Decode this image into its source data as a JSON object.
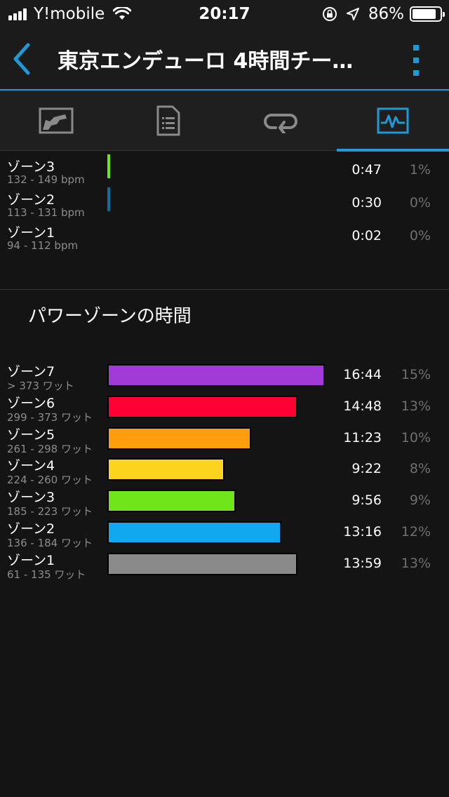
{
  "status_bar": {
    "carrier": "Y!mobile",
    "time": "20:17",
    "battery": "86%",
    "battery_level": 0.86
  },
  "nav": {
    "title": "東京エンデューロ 4時間チー…"
  },
  "tabs": [
    {
      "icon": "map-icon",
      "active": false
    },
    {
      "icon": "summary-document-icon",
      "active": false
    },
    {
      "icon": "laps-loop-icon",
      "active": false
    },
    {
      "icon": "chart-monitor-icon",
      "active": true
    }
  ],
  "colors": {
    "accent": "#1e9ad6",
    "hr_zone3": "#6ee619",
    "hr_zone2": "#119ce6",
    "power_zone7": "#a03bd8",
    "power_zone6": "#ff0033",
    "power_zone5": "#ff9d0f",
    "power_zone4": "#fcd31d",
    "power_zone3": "#6ee619",
    "power_zone2": "#10a8ee",
    "power_zone1": "#8a8a8a"
  },
  "hr_zones": [
    {
      "name": "ゾーン3",
      "range": "132 - 149 bpm",
      "time": "0:47",
      "pct": "1%",
      "fraction": 0.004,
      "color": "#6ee619"
    },
    {
      "name": "ゾーン2",
      "range": "113 - 131 bpm",
      "time": "0:30",
      "pct": "0%",
      "fraction": 0.003,
      "color": "#0f6e9c"
    },
    {
      "name": "ゾーン1",
      "range": "94 - 112 bpm",
      "time": "0:02",
      "pct": "0%",
      "fraction": 0.0,
      "color": ""
    }
  ],
  "power_section": {
    "title": "パワーゾーンの時間"
  },
  "power_zones": [
    {
      "name": "ゾーン7",
      "range": "> 373 ワット",
      "time": "16:44",
      "pct": "15%",
      "fraction": 1.0,
      "color": "#a03bd8"
    },
    {
      "name": "ゾーン6",
      "range": "299 - 373 ワット",
      "time": "14:48",
      "pct": "13%",
      "fraction": 0.875,
      "color": "#ff0033"
    },
    {
      "name": "ゾーン5",
      "range": "261 - 298 ワット",
      "time": "11:23",
      "pct": "10%",
      "fraction": 0.66,
      "color": "#ff9d0f"
    },
    {
      "name": "ゾーン4",
      "range": "224 - 260 ワット",
      "time": "9:22",
      "pct": "8%",
      "fraction": 0.54,
      "color": "#fcd31d"
    },
    {
      "name": "ゾーン3",
      "range": "185 - 223 ワット",
      "time": "9:56",
      "pct": "9%",
      "fraction": 0.59,
      "color": "#6ee619"
    },
    {
      "name": "ゾーン2",
      "range": "136 - 184 ワット",
      "time": "13:16",
      "pct": "12%",
      "fraction": 0.8,
      "color": "#10a8ee"
    },
    {
      "name": "ゾーン1",
      "range": "61 - 135 ワット",
      "time": "13:59",
      "pct": "13%",
      "fraction": 0.875,
      "color": "#8a8a8a"
    }
  ]
}
